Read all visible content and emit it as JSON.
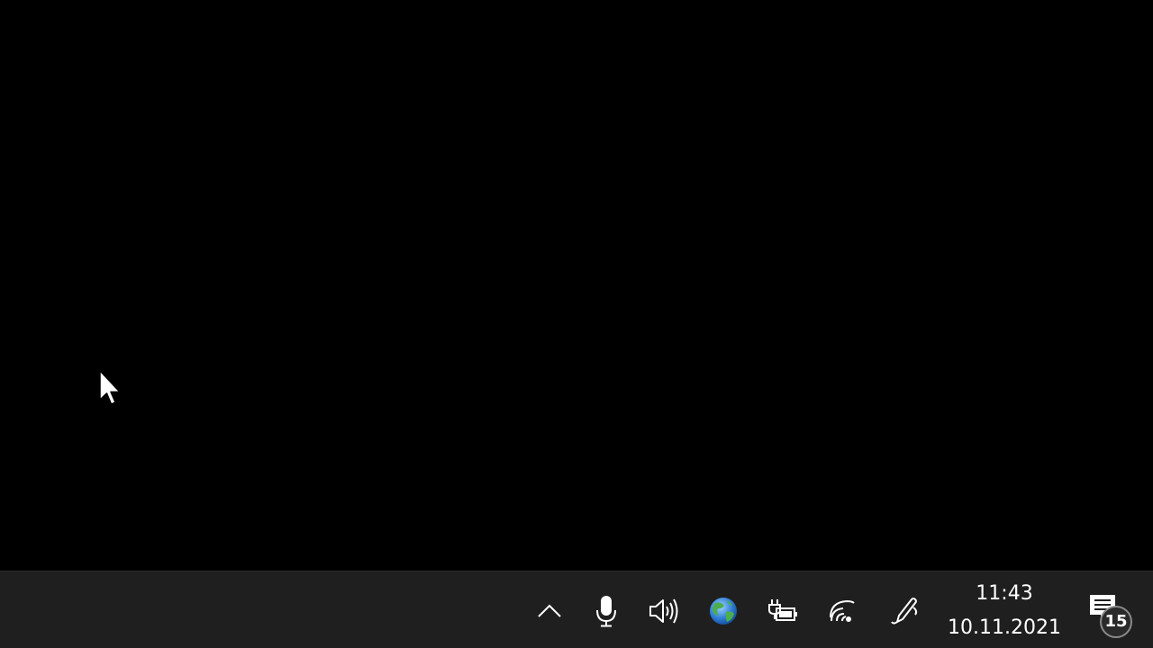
{
  "desktop": {
    "background_color": "#000000"
  },
  "taskbar": {
    "background_color": "#1f1f1f",
    "tray": {
      "items": [
        {
          "name": "show-hidden-icons",
          "icon": "chevron-up-icon"
        },
        {
          "name": "microphone",
          "icon": "microphone-icon"
        },
        {
          "name": "volume",
          "icon": "speaker-icon"
        },
        {
          "name": "network-globe",
          "icon": "globe-icon"
        },
        {
          "name": "power",
          "icon": "battery-charging-icon"
        },
        {
          "name": "wifi",
          "icon": "wifi-icon"
        },
        {
          "name": "pen",
          "icon": "pen-icon"
        }
      ]
    },
    "clock": {
      "time": "11:43",
      "date": "10.11.2021"
    },
    "notifications": {
      "icon": "action-center-icon",
      "count": "15"
    }
  }
}
